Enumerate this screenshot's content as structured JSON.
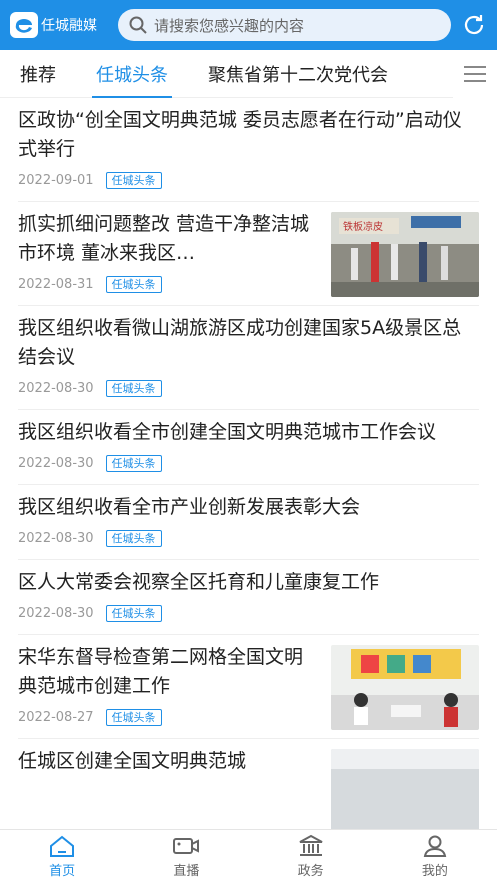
{
  "header": {
    "app_name": "任城融媒",
    "search_placeholder": "请搜索您感兴趣的内容"
  },
  "tabs": [
    {
      "label": "推荐"
    },
    {
      "label": "任城头条"
    },
    {
      "label": "聚焦省第十二次党代会"
    }
  ],
  "articles": [
    {
      "title": "区政协“创全国文明典范城 委员志愿者在行动”启动仪式举行",
      "date": "2022-09-01",
      "tag": "任城头条"
    },
    {
      "title": "抓实抓细问题整改 营造干净整洁城市环境 董冰来我区…",
      "date": "2022-08-31",
      "tag": "任城头条",
      "thumb_sign": "铁板凉皮"
    },
    {
      "title": "我区组织收看微山湖旅游区成功创建国家5A级景区总结会议",
      "date": "2022-08-30",
      "tag": "任城头条"
    },
    {
      "title": "我区组织收看全市创建全国文明典范城市工作会议",
      "date": "2022-08-30",
      "tag": "任城头条"
    },
    {
      "title": "我区组织收看全市产业创新发展表彰大会",
      "date": "2022-08-30",
      "tag": "任城头条"
    },
    {
      "title": "区人大常委会视察全区托育和儿童康复工作",
      "date": "2022-08-30",
      "tag": "任城头条"
    },
    {
      "title": "宋华东督导检查第二网格全国文明典范城市创建工作",
      "date": "2022-08-27",
      "tag": "任城头条"
    },
    {
      "title": "任城区创建全国文明典范城",
      "date": "",
      "tag": ""
    }
  ],
  "bottom_nav": [
    {
      "label": "首页",
      "icon": "home-icon"
    },
    {
      "label": "直播",
      "icon": "video-icon"
    },
    {
      "label": "政务",
      "icon": "government-building-icon"
    },
    {
      "label": "我的",
      "icon": "user-icon"
    }
  ],
  "colors": {
    "accent": "#1f8fe6"
  }
}
